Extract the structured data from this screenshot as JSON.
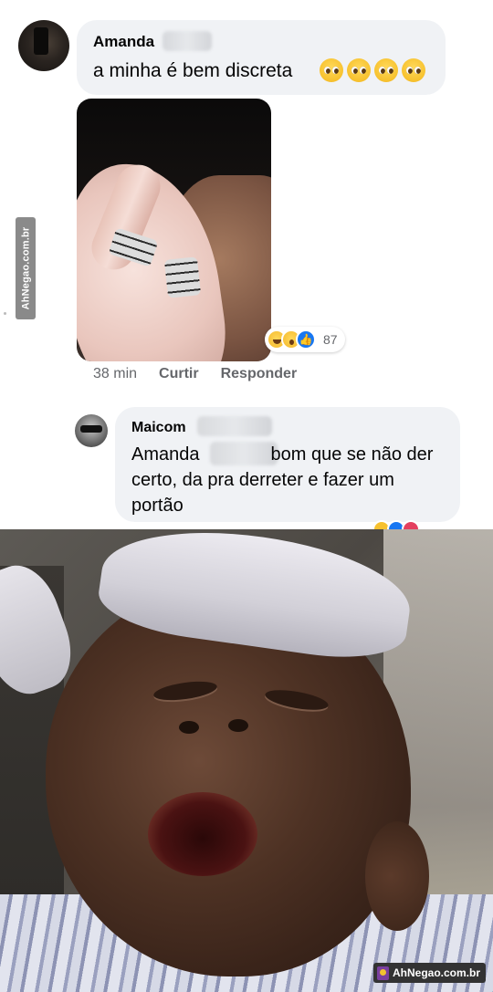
{
  "watermark": {
    "side_text": "AhNegao.com.br",
    "corner_text": "AhNegao.com.br"
  },
  "comment1": {
    "author": "Amanda",
    "text": "a minha é bem discreta",
    "emoji_icons": [
      "pleading-face-icon",
      "pleading-face-icon",
      "pleading-face-icon",
      "pleading-face-icon"
    ],
    "photo": "hands-with-rings-photo",
    "reactions": {
      "icons": [
        "haha-icon",
        "wow-icon",
        "like-icon"
      ],
      "count": "87"
    },
    "time": "38 min",
    "like_label": "Curtir",
    "reply_label": "Responder"
  },
  "comment2": {
    "author": "Maicom",
    "text_start": "Amanda",
    "text_rest": "bom que se não der certo, da pra derreter e fazer um portão"
  },
  "colors": {
    "bubble_bg": "#f0f2f5",
    "meta_text": "#65676b",
    "like_blue": "#1877f2"
  }
}
